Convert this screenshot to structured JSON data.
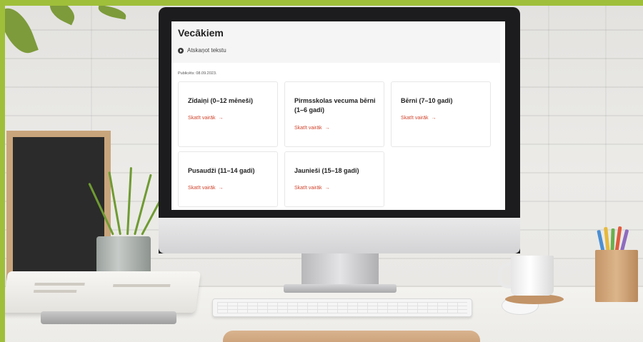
{
  "page": {
    "title": "Vecākiem",
    "listen_label": "Atskaņot tekstu",
    "published": "Publicēts: 08.09.2023."
  },
  "cards": [
    {
      "title": "Zīdaiņi (0–12 mēneši)",
      "link": "Skatīt vairāk",
      "arrow": "→"
    },
    {
      "title": "Pirmsskolas vecuma bērni (1–6 gadi)",
      "link": "Skatīt vairāk",
      "arrow": "→"
    },
    {
      "title": "Bērni (7–10 gadi)",
      "link": "Skatīt vairāk",
      "arrow": "→"
    },
    {
      "title": "Pusaudži (11–14 gadi)",
      "link": "Skatīt vairāk",
      "arrow": "→"
    },
    {
      "title": "Jaunieši (15–18 gadi)",
      "link": "Skatīt vairāk",
      "arrow": "→"
    }
  ],
  "icons": {
    "listen": "play-icon",
    "card_link": "arrow-right-icon"
  },
  "colors": {
    "frame": "#9fbf3a",
    "link": "#d0452e",
    "header_bg": "#f5f5f5"
  }
}
